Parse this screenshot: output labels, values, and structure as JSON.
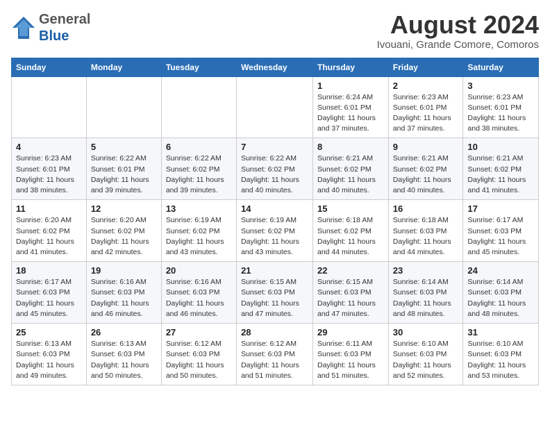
{
  "header": {
    "logo_line1": "General",
    "logo_line2": "Blue",
    "month_year": "August 2024",
    "location": "Ivouani, Grande Comore, Comoros"
  },
  "columns": [
    "Sunday",
    "Monday",
    "Tuesday",
    "Wednesday",
    "Thursday",
    "Friday",
    "Saturday"
  ],
  "weeks": [
    [
      {
        "day": "",
        "info": ""
      },
      {
        "day": "",
        "info": ""
      },
      {
        "day": "",
        "info": ""
      },
      {
        "day": "",
        "info": ""
      },
      {
        "day": "1",
        "info": "Sunrise: 6:24 AM\nSunset: 6:01 PM\nDaylight: 11 hours\nand 37 minutes."
      },
      {
        "day": "2",
        "info": "Sunrise: 6:23 AM\nSunset: 6:01 PM\nDaylight: 11 hours\nand 37 minutes."
      },
      {
        "day": "3",
        "info": "Sunrise: 6:23 AM\nSunset: 6:01 PM\nDaylight: 11 hours\nand 38 minutes."
      }
    ],
    [
      {
        "day": "4",
        "info": "Sunrise: 6:23 AM\nSunset: 6:01 PM\nDaylight: 11 hours\nand 38 minutes."
      },
      {
        "day": "5",
        "info": "Sunrise: 6:22 AM\nSunset: 6:01 PM\nDaylight: 11 hours\nand 39 minutes."
      },
      {
        "day": "6",
        "info": "Sunrise: 6:22 AM\nSunset: 6:02 PM\nDaylight: 11 hours\nand 39 minutes."
      },
      {
        "day": "7",
        "info": "Sunrise: 6:22 AM\nSunset: 6:02 PM\nDaylight: 11 hours\nand 40 minutes."
      },
      {
        "day": "8",
        "info": "Sunrise: 6:21 AM\nSunset: 6:02 PM\nDaylight: 11 hours\nand 40 minutes."
      },
      {
        "day": "9",
        "info": "Sunrise: 6:21 AM\nSunset: 6:02 PM\nDaylight: 11 hours\nand 40 minutes."
      },
      {
        "day": "10",
        "info": "Sunrise: 6:21 AM\nSunset: 6:02 PM\nDaylight: 11 hours\nand 41 minutes."
      }
    ],
    [
      {
        "day": "11",
        "info": "Sunrise: 6:20 AM\nSunset: 6:02 PM\nDaylight: 11 hours\nand 41 minutes."
      },
      {
        "day": "12",
        "info": "Sunrise: 6:20 AM\nSunset: 6:02 PM\nDaylight: 11 hours\nand 42 minutes."
      },
      {
        "day": "13",
        "info": "Sunrise: 6:19 AM\nSunset: 6:02 PM\nDaylight: 11 hours\nand 43 minutes."
      },
      {
        "day": "14",
        "info": "Sunrise: 6:19 AM\nSunset: 6:02 PM\nDaylight: 11 hours\nand 43 minutes."
      },
      {
        "day": "15",
        "info": "Sunrise: 6:18 AM\nSunset: 6:02 PM\nDaylight: 11 hours\nand 44 minutes."
      },
      {
        "day": "16",
        "info": "Sunrise: 6:18 AM\nSunset: 6:03 PM\nDaylight: 11 hours\nand 44 minutes."
      },
      {
        "day": "17",
        "info": "Sunrise: 6:17 AM\nSunset: 6:03 PM\nDaylight: 11 hours\nand 45 minutes."
      }
    ],
    [
      {
        "day": "18",
        "info": "Sunrise: 6:17 AM\nSunset: 6:03 PM\nDaylight: 11 hours\nand 45 minutes."
      },
      {
        "day": "19",
        "info": "Sunrise: 6:16 AM\nSunset: 6:03 PM\nDaylight: 11 hours\nand 46 minutes."
      },
      {
        "day": "20",
        "info": "Sunrise: 6:16 AM\nSunset: 6:03 PM\nDaylight: 11 hours\nand 46 minutes."
      },
      {
        "day": "21",
        "info": "Sunrise: 6:15 AM\nSunset: 6:03 PM\nDaylight: 11 hours\nand 47 minutes."
      },
      {
        "day": "22",
        "info": "Sunrise: 6:15 AM\nSunset: 6:03 PM\nDaylight: 11 hours\nand 47 minutes."
      },
      {
        "day": "23",
        "info": "Sunrise: 6:14 AM\nSunset: 6:03 PM\nDaylight: 11 hours\nand 48 minutes."
      },
      {
        "day": "24",
        "info": "Sunrise: 6:14 AM\nSunset: 6:03 PM\nDaylight: 11 hours\nand 48 minutes."
      }
    ],
    [
      {
        "day": "25",
        "info": "Sunrise: 6:13 AM\nSunset: 6:03 PM\nDaylight: 11 hours\nand 49 minutes."
      },
      {
        "day": "26",
        "info": "Sunrise: 6:13 AM\nSunset: 6:03 PM\nDaylight: 11 hours\nand 50 minutes."
      },
      {
        "day": "27",
        "info": "Sunrise: 6:12 AM\nSunset: 6:03 PM\nDaylight: 11 hours\nand 50 minutes."
      },
      {
        "day": "28",
        "info": "Sunrise: 6:12 AM\nSunset: 6:03 PM\nDaylight: 11 hours\nand 51 minutes."
      },
      {
        "day": "29",
        "info": "Sunrise: 6:11 AM\nSunset: 6:03 PM\nDaylight: 11 hours\nand 51 minutes."
      },
      {
        "day": "30",
        "info": "Sunrise: 6:10 AM\nSunset: 6:03 PM\nDaylight: 11 hours\nand 52 minutes."
      },
      {
        "day": "31",
        "info": "Sunrise: 6:10 AM\nSunset: 6:03 PM\nDaylight: 11 hours\nand 53 minutes."
      }
    ]
  ]
}
